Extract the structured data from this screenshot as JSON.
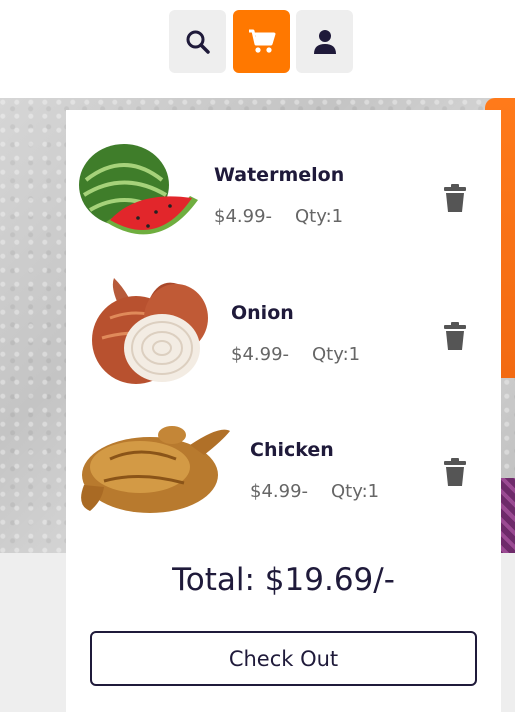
{
  "header": {
    "icons": [
      {
        "name": "search-icon"
      },
      {
        "name": "cart-icon",
        "color": "#ff7800"
      },
      {
        "name": "user-icon"
      }
    ]
  },
  "cart": {
    "items": [
      {
        "name": "Watermelon",
        "price": "$4.99-",
        "qty": "Qty:1"
      },
      {
        "name": "Onion",
        "price": "$4.99-",
        "qty": "Qty:1"
      },
      {
        "name": "Chicken",
        "price": "$4.99-",
        "qty": "Qty:1"
      }
    ],
    "total": "Total: $19.69/-",
    "checkout_label": "Check Out"
  },
  "colors": {
    "accent": "#ff7800",
    "text_dark": "#1f1a3a",
    "muted": "#666666"
  }
}
